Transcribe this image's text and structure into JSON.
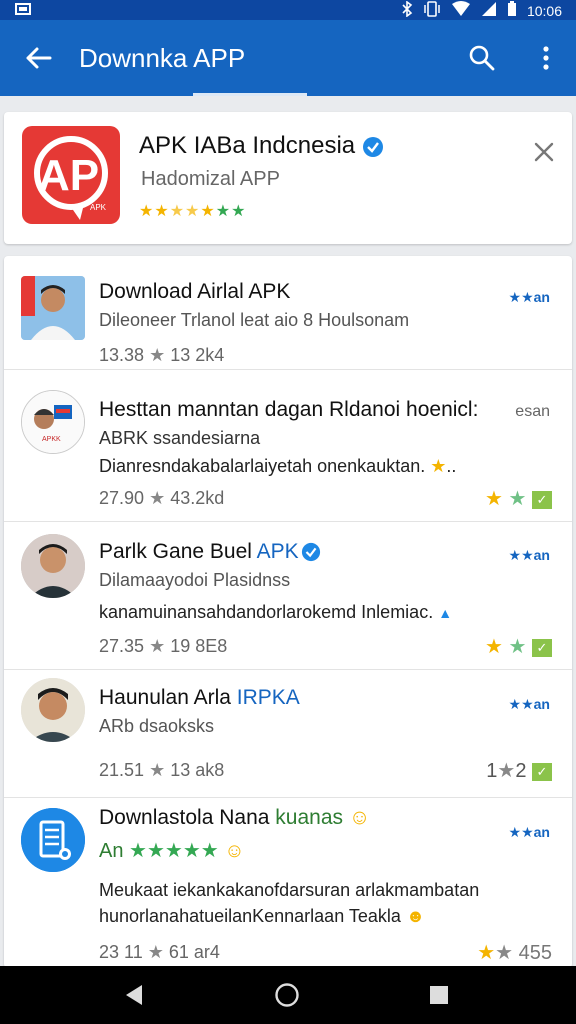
{
  "status_bar": {
    "time": "10:06"
  },
  "app_bar": {
    "title": "Downnka APP"
  },
  "featured": {
    "name": "APK IABa Indcnesia",
    "subtitle": "Hadomizal APP",
    "stars": "★★★★★★★",
    "brand_color": "#e53935"
  },
  "items": [
    {
      "title": "Download Airlal APK",
      "line2": "Dileoneer Trlanol leat aio 8 Houlsonam",
      "meta_left": "13.38",
      "meta_right": "13 2k4",
      "badge": "★★an",
      "avatar_icon": "person-photo-icon"
    },
    {
      "title": "Hesttan manntan dagan Rldanoi hoenicl:",
      "title_suffix": "esan",
      "line2": "ABRK ssandesiarna",
      "desc": "Dianresndakabalarlaiyetah onenkauktan.",
      "meta_left": "27.90",
      "meta_right": "43.2kd",
      "avatar_icon": "person-photo-icon"
    },
    {
      "title": "Parlk Gane Buel",
      "title_accent": "APK",
      "line2": "Dilamaayodoi Plasidnss",
      "desc": "kanamuinansahdandorlarokemd Inlemiac.",
      "meta_left": "27.35",
      "meta_right": "19 8E8",
      "badge": "★★an",
      "avatar_icon": "person-photo-icon"
    },
    {
      "title": "Haunulan Arla",
      "title_accent": "IRPKA",
      "line2": "ARb dsaoksks",
      "meta_left": "21.51",
      "meta_right": "13 ak8",
      "badge": "★★an",
      "rating_left": "1",
      "rating_right": "2",
      "avatar_icon": "person-photo-icon"
    },
    {
      "title": "Downlastola Nana",
      "title_accent": "kuanas",
      "line2": "An",
      "desc": "Meukaat iekankakanofdarsuran arlakmambatan",
      "desc2": "hunorlanahatueilanKennarlaan Teakla",
      "meta_left": "23 11",
      "meta_right": "61 ar4",
      "badge": "★★an",
      "rating_right": "455",
      "avatar_icon": "document-app-icon"
    }
  ]
}
